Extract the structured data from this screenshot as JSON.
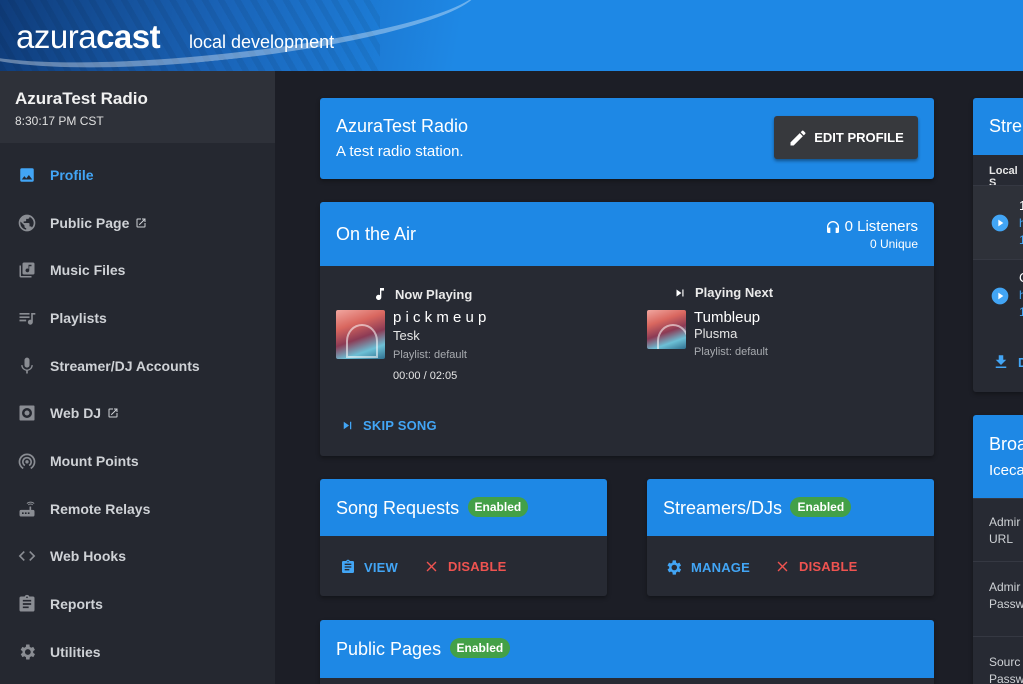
{
  "header": {
    "logo_light": "azura",
    "logo_bold": "cast",
    "tagline": "local development"
  },
  "sidebar": {
    "station_name": "AzuraTest Radio",
    "time": "8:30:17 PM CST",
    "items": [
      {
        "label": "Profile",
        "icon": "image-icon",
        "active": true
      },
      {
        "label": "Public Page",
        "icon": "globe-icon",
        "external": true
      },
      {
        "label": "Music Files",
        "icon": "library-music-icon"
      },
      {
        "label": "Playlists",
        "icon": "queue-music-icon"
      },
      {
        "label": "Streamer/DJ Accounts",
        "icon": "mic-icon"
      },
      {
        "label": "Web DJ",
        "icon": "speaker-icon",
        "external": true
      },
      {
        "label": "Mount Points",
        "icon": "wifi-tethering-icon"
      },
      {
        "label": "Remote Relays",
        "icon": "router-icon"
      },
      {
        "label": "Web Hooks",
        "icon": "code-icon"
      },
      {
        "label": "Reports",
        "icon": "assignment-icon"
      },
      {
        "label": "Utilities",
        "icon": "settings-icon"
      }
    ]
  },
  "profile": {
    "title": "AzuraTest Radio",
    "description": "A test radio station.",
    "edit_label": "EDIT PROFILE"
  },
  "on_air": {
    "title": "On the Air",
    "listeners": "0 Listeners",
    "unique": "0 Unique",
    "now_playing": {
      "label": "Now Playing",
      "title": "p i c k m e u p",
      "artist": "Tesk",
      "playlist": "Playlist: default",
      "time": "00:00 / 02:05"
    },
    "playing_next": {
      "label": "Playing Next",
      "title": "Tumbleup",
      "artist": "Plusma",
      "playlist": "Playlist: default"
    },
    "skip_label": "SKIP SONG"
  },
  "song_requests": {
    "title": "Song Requests",
    "badge": "Enabled",
    "view_label": "VIEW",
    "disable_label": "DISABLE"
  },
  "streamers": {
    "title": "Streamers/DJs",
    "badge": "Enabled",
    "manage_label": "MANAGE",
    "disable_label": "DISABLE"
  },
  "public_pages": {
    "title": "Public Pages",
    "badge": "Enabled"
  },
  "right_col": {
    "streams_title": "Stre",
    "local_label": "Local S",
    "row1": {
      "num": "1",
      "link": "h",
      "sub": "1"
    },
    "row2": {
      "num": "C",
      "link": "h",
      "sub": "1"
    },
    "download_label": "D",
    "broadcast_title": "Broa",
    "broadcast_sub": "Iceca",
    "admin_url_1": "Admir",
    "admin_url_2": "URL",
    "admin_pw_1": "Admir",
    "admin_pw_2": "Passw",
    "source_1": "Sourc",
    "source_2": "Passw"
  },
  "colors": {
    "accent": "#1e88e5",
    "badge": "#43a047",
    "danger": "#ef5350",
    "link": "#42a5f5"
  }
}
